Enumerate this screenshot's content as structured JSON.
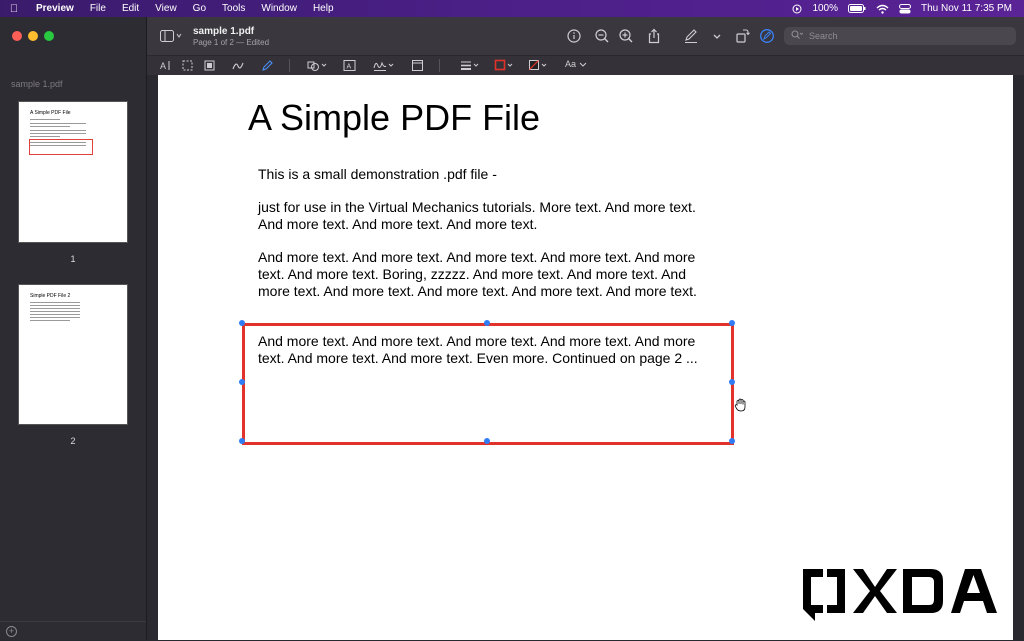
{
  "menubar": {
    "app": "Preview",
    "items": [
      "File",
      "Edit",
      "View",
      "Go",
      "Tools",
      "Window",
      "Help"
    ],
    "battery": "100%",
    "clock": "Thu Nov 11  7:35 PM"
  },
  "sidebar": {
    "doc_name": "sample 1.pdf",
    "pages": [
      {
        "label": "1",
        "thumb_title": "A Simple PDF File"
      },
      {
        "label": "2",
        "thumb_title": "Simple PDF File 2"
      }
    ]
  },
  "toolbar": {
    "title": "sample 1.pdf",
    "subtitle": "Page 1 of 2 — Edited",
    "search_placeholder": "Search"
  },
  "markup": {
    "font_button": "Aa"
  },
  "document": {
    "title": "A Simple PDF File",
    "paragraphs": [
      "This is a small demonstration .pdf file -",
      "just for use in the Virtual Mechanics tutorials. More text. And more text. And more text. And more text. And more text.",
      "And more text. And more text. And more text. And more text. And more text. And more text. Boring, zzzzz. And more text. And more text. And more text. And more text. And more text. And more text. And more text.",
      "And more text. And more text. And more text. And more text. And more text. And more text. And more text. Even more. Continued on page 2 ..."
    ]
  },
  "colors": {
    "menubar_accent": "#4a1f86",
    "selection": "#e2332a",
    "handle": "#2f7cf6"
  },
  "watermark": "XDA"
}
